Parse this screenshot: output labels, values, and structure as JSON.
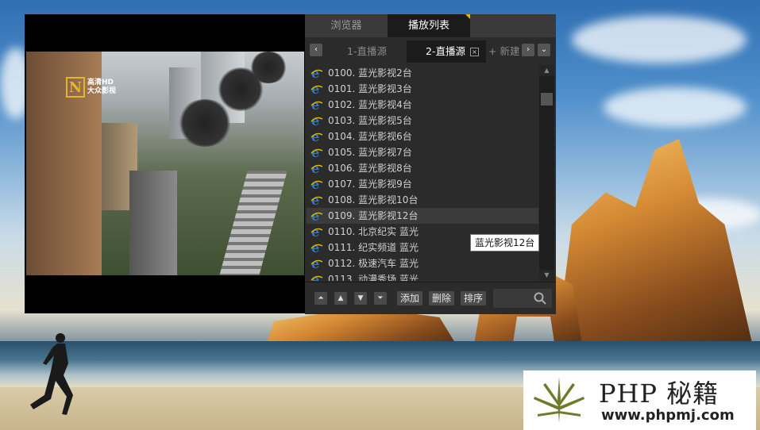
{
  "player": {
    "channel_logo": {
      "line1": "高清HD",
      "line2": "大众影视"
    }
  },
  "panel": {
    "top_tabs": [
      {
        "label": "浏览器",
        "active": false
      },
      {
        "label": "播放列表",
        "active": true
      }
    ],
    "sub_tabs": [
      {
        "label": "1-直播源",
        "active": false
      },
      {
        "label": "2-直播源",
        "active": true
      },
      {
        "label": "+ 新建",
        "active": false
      }
    ],
    "items": [
      "0100. 蓝光影视2台",
      "0101. 蓝光影视3台",
      "0102. 蓝光影视4台",
      "0103. 蓝光影视5台",
      "0104. 蓝光影视6台",
      "0105. 蓝光影视7台",
      "0106. 蓝光影视8台",
      "0107. 蓝光影视9台",
      "0108. 蓝光影视10台",
      "0109. 蓝光影视12台",
      "0110. 北京纪实  蓝光",
      "0111. 纪实频道  蓝光",
      "0112. 极速汽车  蓝光",
      "0113. 动漫秀场  蓝光"
    ],
    "highlighted_index": 9,
    "tooltip": "蓝光影视12台",
    "actions": {
      "add": "添加",
      "delete": "删除",
      "sort": "排序"
    },
    "search": {
      "value": "",
      "placeholder": ""
    },
    "icons": [
      "chevron-left-icon",
      "chevron-right-icon",
      "chevron-down-icon",
      "close-icon",
      "ie-icon",
      "move-top-icon",
      "move-up-icon",
      "move-down-icon",
      "move-bottom-icon",
      "search-icon"
    ]
  },
  "watermark": {
    "title": "PHP 秘籍",
    "url": "www.phpmj.com"
  },
  "colors": {
    "accent": "#e6b300",
    "panel_bg": "#2b2b2b",
    "active_tab_bg": "#1b1b1b",
    "ie_blue": "#1e7fd6"
  }
}
